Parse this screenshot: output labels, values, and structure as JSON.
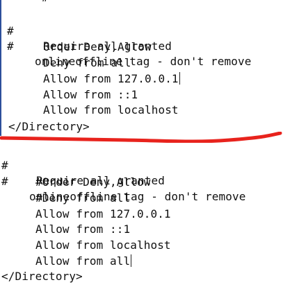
{
  "top_block": {
    "line0": "#",
    "line1_hash": "#",
    "line1_text": "Require all granted",
    "line2_hash": "#",
    "line2_text": "onlineoffline tag - don't remove",
    "line3": "Order Deny,Allow",
    "line4": "Deny from all",
    "line5": "Allow from 127.0.0.1",
    "line6": "Allow from ::1",
    "line7": "Allow from localhost",
    "closing": "</Directory>"
  },
  "bottom_block": {
    "line1_hash": "#",
    "line1_text": "Require all granted",
    "line2_hash": "#",
    "line2_text": "onlineoffline tag - don't remove",
    "line3": "#Order Deny,Allow",
    "line4": "#Deny from all",
    "line5": "Allow from 127.0.0.1",
    "line6": "Allow from ::1",
    "line7": "Allow from localhost",
    "line8": "Allow from all",
    "closing": "</Directory>"
  },
  "colors": {
    "separator": "#e8231d",
    "editor_border": "#2d4f9b"
  }
}
